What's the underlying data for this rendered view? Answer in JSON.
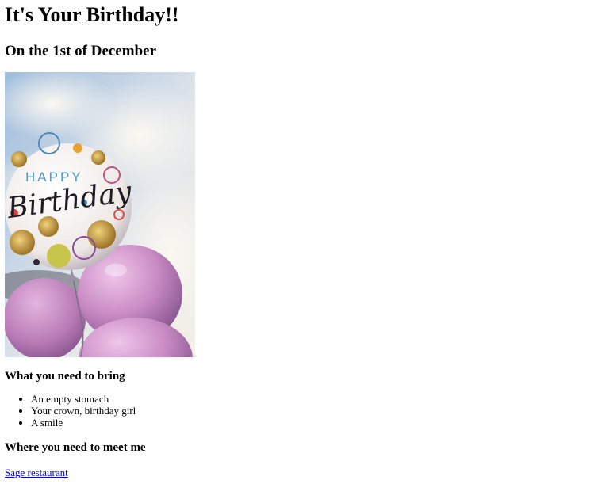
{
  "heading": "It's Your Birthday!!",
  "subheading": "On the 1st of December",
  "image": {
    "balloon_text_top": "HAPPY",
    "balloon_text_main": "Birthday",
    "colors": {
      "sky_blue": "#8fb3d9",
      "cloud": "#f3f0ea",
      "balloon_pink": "#c98bc4",
      "balloon_white": "#f7f4f2",
      "gold": "#c8a048"
    }
  },
  "bring_section": {
    "title": "What you need to bring",
    "items": [
      "An empty stomach",
      "Your crown, birthday girl",
      "A smile"
    ]
  },
  "meet_section": {
    "title": "Where you need to meet me",
    "link_text": "Sage restaurant"
  }
}
